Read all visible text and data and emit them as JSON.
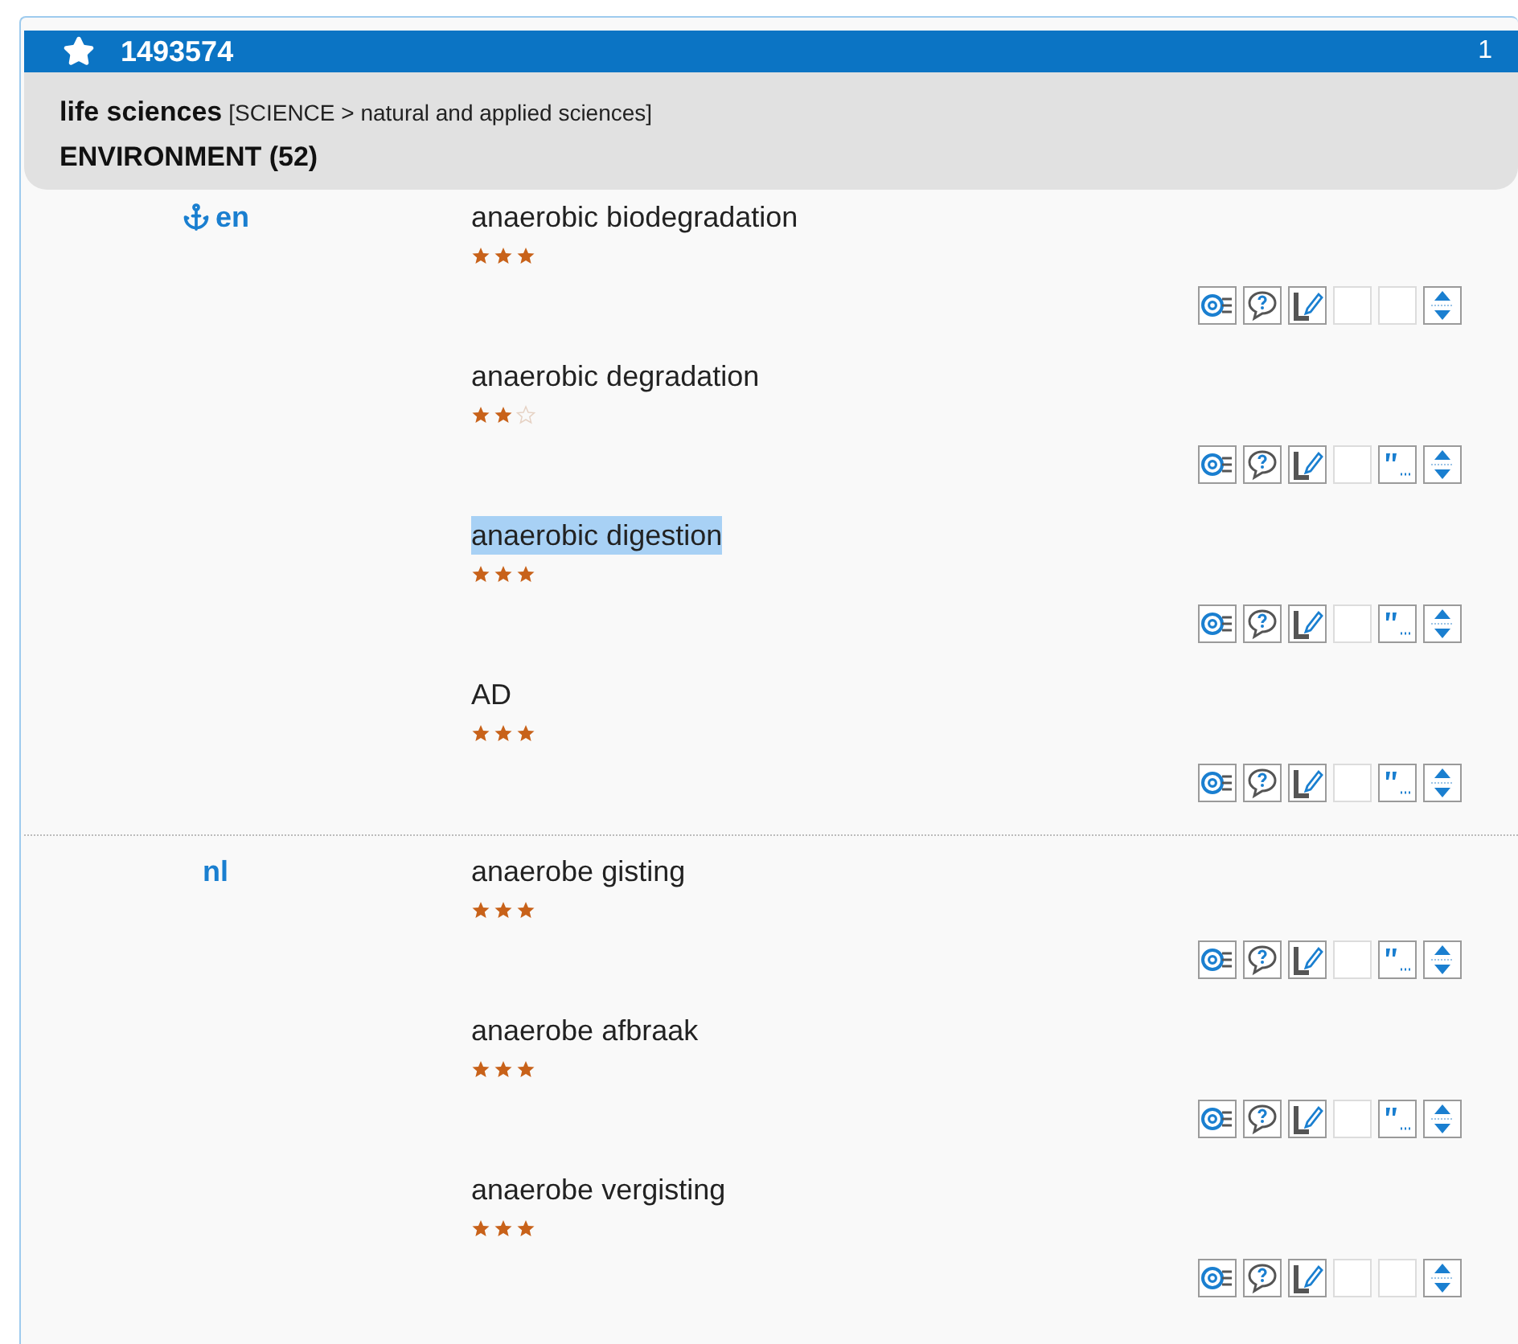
{
  "header": {
    "id": "1493574",
    "count": "1"
  },
  "domain": {
    "name": "life sciences",
    "path": "[SCIENCE > natural and applied sciences]",
    "subdomain": "ENVIRONMENT (52)"
  },
  "languages": [
    {
      "code": "en",
      "anchor": true,
      "terms": [
        {
          "text": "anaerobic biodegradation",
          "stars": 3,
          "highlighted": false,
          "has_context": false
        },
        {
          "text": "anaerobic degradation",
          "stars": 2,
          "highlighted": false,
          "has_context": true
        },
        {
          "text": "anaerobic digestion",
          "stars": 3,
          "highlighted": true,
          "has_context": true
        },
        {
          "text": "AD",
          "stars": 3,
          "highlighted": false,
          "has_context": true
        }
      ]
    },
    {
      "code": "nl",
      "anchor": false,
      "terms": [
        {
          "text": "anaerobe gisting",
          "stars": 3,
          "highlighted": false,
          "has_context": true
        },
        {
          "text": "anaerobe afbraak",
          "stars": 3,
          "highlighted": false,
          "has_context": true
        },
        {
          "text": "anaerobe vergisting",
          "stars": 3,
          "highlighted": false,
          "has_context": false
        }
      ]
    }
  ]
}
